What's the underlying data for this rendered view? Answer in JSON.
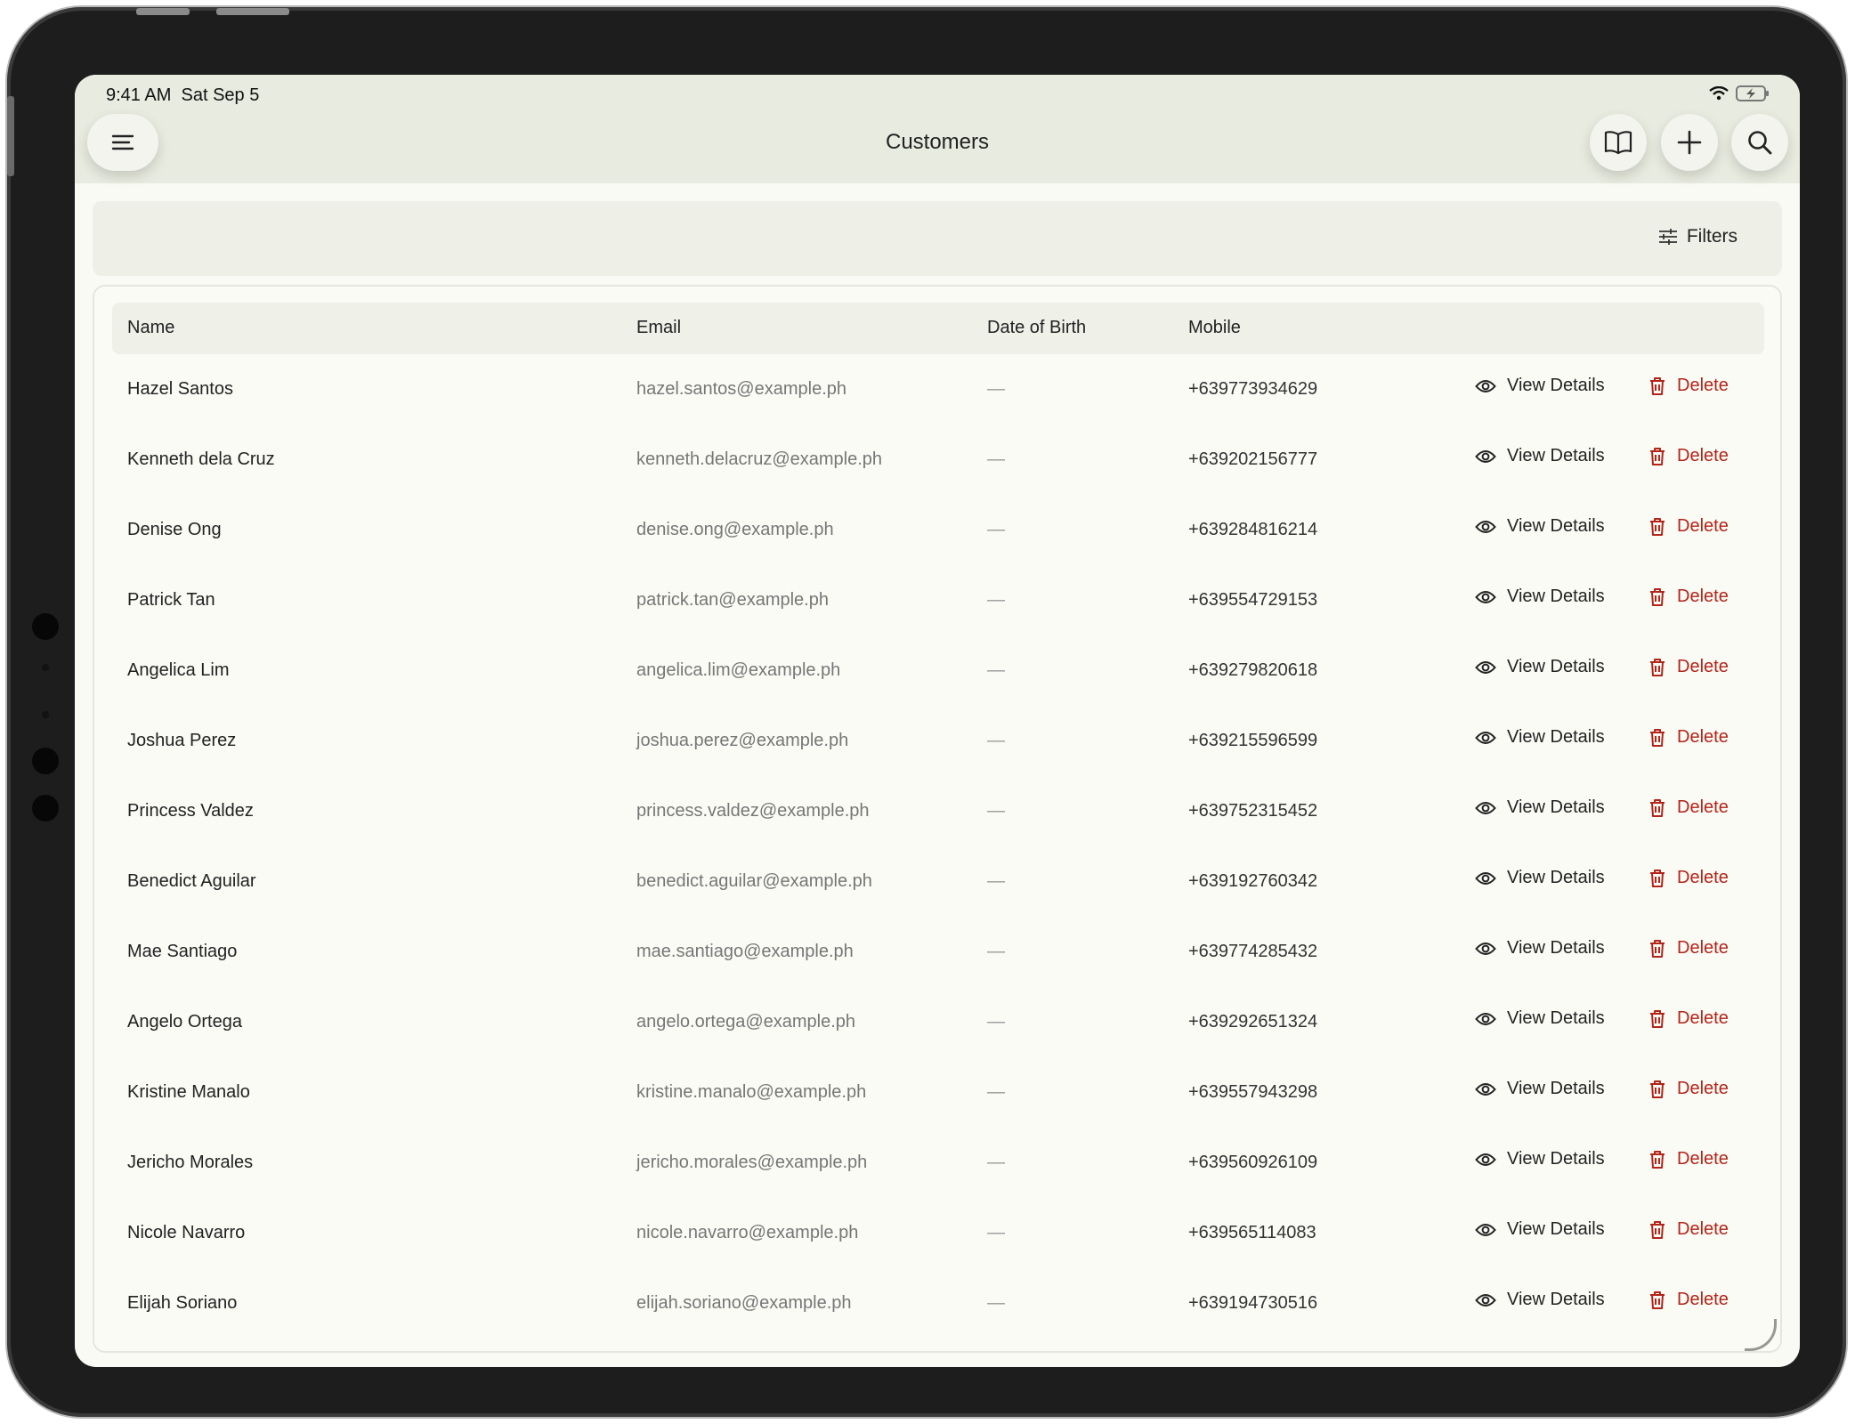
{
  "status_bar": {
    "time": "9:41 AM",
    "date": "Sat Sep 5"
  },
  "header": {
    "title": "Customers",
    "menu_icon": "menu-icon",
    "actions": [
      "book-icon",
      "plus-icon",
      "search-icon"
    ]
  },
  "filters": {
    "label": "Filters",
    "icon": "sliders-icon"
  },
  "table": {
    "columns": [
      "Name",
      "Email",
      "Date of Birth",
      "Mobile"
    ],
    "action_view": "View Details",
    "action_delete": "Delete",
    "rows": [
      {
        "name": "Hazel Santos",
        "email": "hazel.santos@example.ph",
        "dob": "—",
        "mobile": "+639773934629"
      },
      {
        "name": "Kenneth dela Cruz",
        "email": "kenneth.delacruz@example.ph",
        "dob": "—",
        "mobile": "+639202156777"
      },
      {
        "name": "Denise Ong",
        "email": "denise.ong@example.ph",
        "dob": "—",
        "mobile": "+639284816214"
      },
      {
        "name": "Patrick Tan",
        "email": "patrick.tan@example.ph",
        "dob": "—",
        "mobile": "+639554729153"
      },
      {
        "name": "Angelica Lim",
        "email": "angelica.lim@example.ph",
        "dob": "—",
        "mobile": "+639279820618"
      },
      {
        "name": "Joshua Perez",
        "email": "joshua.perez@example.ph",
        "dob": "—",
        "mobile": "+639215596599"
      },
      {
        "name": "Princess Valdez",
        "email": "princess.valdez@example.ph",
        "dob": "—",
        "mobile": "+639752315452"
      },
      {
        "name": "Benedict Aguilar",
        "email": "benedict.aguilar@example.ph",
        "dob": "—",
        "mobile": "+639192760342"
      },
      {
        "name": "Mae Santiago",
        "email": "mae.santiago@example.ph",
        "dob": "—",
        "mobile": "+639774285432"
      },
      {
        "name": "Angelo Ortega",
        "email": "angelo.ortega@example.ph",
        "dob": "—",
        "mobile": "+639292651324"
      },
      {
        "name": "Kristine Manalo",
        "email": "kristine.manalo@example.ph",
        "dob": "—",
        "mobile": "+639557943298"
      },
      {
        "name": "Jericho Morales",
        "email": "jericho.morales@example.ph",
        "dob": "—",
        "mobile": "+639560926109"
      },
      {
        "name": "Nicole Navarro",
        "email": "nicole.navarro@example.ph",
        "dob": "—",
        "mobile": "+639565114083"
      },
      {
        "name": "Elijah Soriano",
        "email": "elijah.soriano@example.ph",
        "dob": "—",
        "mobile": "+639194730516"
      }
    ]
  },
  "colors": {
    "header_bg": "#e8ebdf",
    "page_bg": "#fafaf5",
    "delete": "#b42318"
  }
}
